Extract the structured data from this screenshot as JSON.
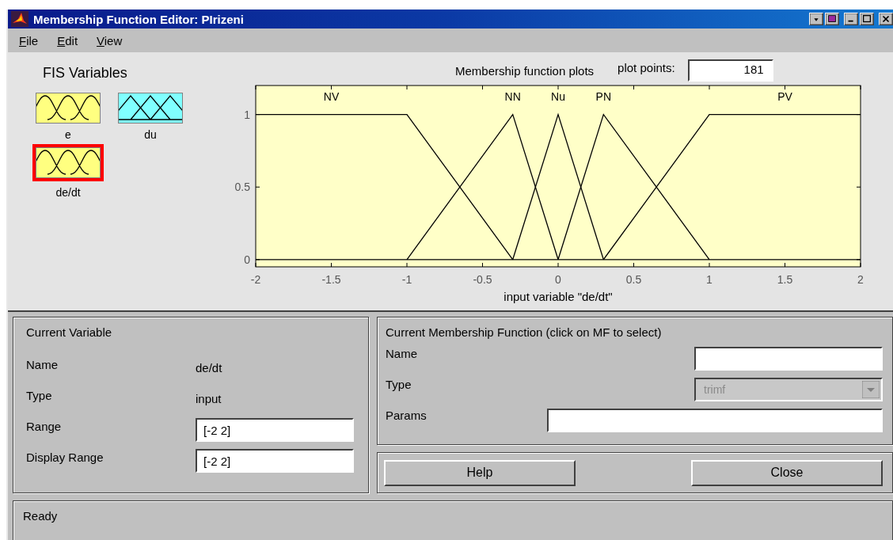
{
  "window": {
    "title": "Membership Function Editor: PIrizeni"
  },
  "menu": [
    "File",
    "Edit",
    "View"
  ],
  "fis_variables": {
    "title": "FIS Variables",
    "items": [
      {
        "name": "e",
        "kind": "gauss",
        "color": "#ffff80",
        "selected": false
      },
      {
        "name": "du",
        "kind": "tri",
        "color": "#80ffff",
        "selected": false
      },
      {
        "name": "de/dt",
        "kind": "gauss",
        "color": "#ffff80",
        "selected": true
      }
    ]
  },
  "plot": {
    "title": "Membership function plots",
    "plot_points_label": "plot points:",
    "plot_points": "181",
    "chart_data": {
      "type": "line",
      "xlabel": "input variable \"de/dt\"",
      "x": [
        -2,
        -1,
        -0.3,
        0,
        0.3,
        1,
        2
      ],
      "series": [
        {
          "name": "NV",
          "color": "#000000",
          "values": [
            1,
            1,
            0,
            null,
            null,
            null,
            null
          ]
        },
        {
          "name": "NN",
          "color": "#000000",
          "values": [
            null,
            0,
            1,
            0,
            null,
            null,
            null
          ]
        },
        {
          "name": "Nu",
          "color": "#000000",
          "values": [
            null,
            null,
            0,
            1,
            0,
            null,
            null
          ]
        },
        {
          "name": "PN",
          "color": "#000000",
          "values": [
            null,
            null,
            null,
            0,
            1,
            0,
            null
          ]
        },
        {
          "name": "PV",
          "color": "#000000",
          "values": [
            null,
            null,
            null,
            null,
            0,
            1,
            1
          ]
        }
      ],
      "legend": true,
      "xlim": [
        -2,
        2
      ],
      "ylim": [
        -0.05,
        1.2
      ],
      "xticks": [
        {
          "value": -2,
          "label": "-2"
        },
        {
          "value": -1.5,
          "label": "-1.5"
        },
        {
          "value": -1,
          "label": "-1"
        },
        {
          "value": -0.5,
          "label": "-0.5"
        },
        {
          "value": 0,
          "label": "0"
        },
        {
          "value": 0.5,
          "label": "0.5"
        },
        {
          "value": 1,
          "label": "1"
        },
        {
          "value": 1.5,
          "label": "1.5"
        },
        {
          "value": 2,
          "label": "2"
        }
      ],
      "yticks": [
        {
          "value": 0,
          "label": "0"
        },
        {
          "value": 0.5,
          "label": "0.5"
        },
        {
          "value": 1,
          "label": "1"
        }
      ]
    }
  },
  "current_variable": {
    "title": "Current Variable",
    "rows": [
      {
        "label": "Name",
        "kind": "text",
        "value": "de/dt"
      },
      {
        "label": "Type",
        "kind": "text",
        "value": "input"
      },
      {
        "label": "Range",
        "kind": "field",
        "value": "[-2 2]"
      },
      {
        "label": "Display Range",
        "kind": "field",
        "value": "[-2 2]"
      }
    ]
  },
  "current_mf": {
    "title": "Current Membership Function (click on MF to select)",
    "name_label": "Name",
    "type_label": "Type",
    "type_value": "trimf",
    "type_disabled": true,
    "params_label": "Params"
  },
  "buttons": [
    "Help",
    "Close"
  ],
  "status_bar": "Ready"
}
